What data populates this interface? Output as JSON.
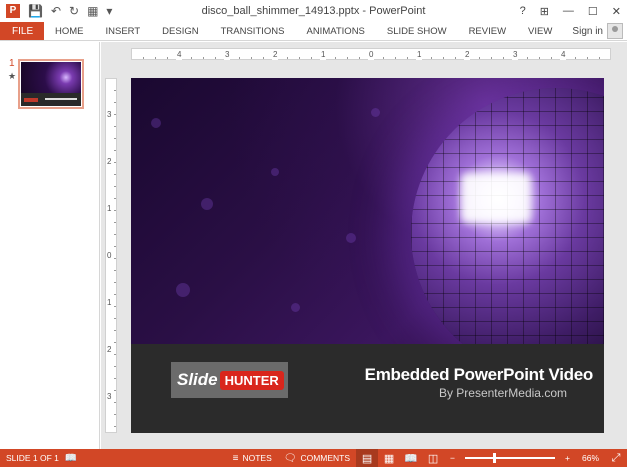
{
  "window": {
    "title": "disco_ball_shimmer_14913.pptx - PowerPoint",
    "app_letter": "P",
    "controls": [
      "?",
      "⊞",
      "—",
      "☐",
      "✕"
    ]
  },
  "ribbon": {
    "file": "FILE",
    "tabs": [
      "HOME",
      "INSERT",
      "DESIGN",
      "TRANSITIONS",
      "ANIMATIONS",
      "SLIDE SHOW",
      "REVIEW",
      "VIEW"
    ],
    "signin": "Sign in"
  },
  "thumbnails": {
    "number": "1",
    "star": "★"
  },
  "ruler": {
    "h_labels": [
      "4",
      "3",
      "2",
      "1",
      "0",
      "1",
      "2",
      "3",
      "4"
    ],
    "v_labels": [
      "3",
      "2",
      "1",
      "0",
      "1",
      "2",
      "3"
    ]
  },
  "slide": {
    "logo_slide": "Slide",
    "logo_hunter": "HUNTER",
    "title": "Embedded PowerPoint Video",
    "subtitle": "By PresenterMedia.com"
  },
  "status": {
    "slide_info": "SLIDE 1 OF 1",
    "notes": "NOTES",
    "comments": "COMMENTS",
    "zoom_minus": "−",
    "zoom_plus": "+",
    "zoom": "66%",
    "zoom_level": 0.66
  },
  "colors": {
    "accent": "#d24726",
    "band": "#2b2b2b"
  }
}
